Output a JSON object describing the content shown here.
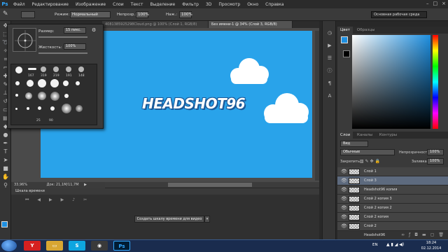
{
  "menubar": {
    "logo": "Ps",
    "items": [
      "Файл",
      "Редактирование",
      "Изображение",
      "Слои",
      "Текст",
      "Выделение",
      "Фильтр",
      "3D",
      "Просмотр",
      "Окно",
      "Справка"
    ],
    "window_controls": [
      "–",
      "□",
      "×"
    ]
  },
  "options": {
    "mode_label": "Режим:",
    "mode_value": "Нормальный",
    "opacity_label": "Непрозр.:",
    "opacity_value": "100%",
    "flow_label": "Наж.:",
    "flow_value": "100%",
    "workspace": "Основная рабочая среда"
  },
  "tabs": [
    {
      "label": "4081385925298Cloud.png @ 100% (Слой 1, RGB/8)",
      "active": false
    },
    {
      "label": "Без имени-1 @ 34% (Слой 3, RGB/8)",
      "active": true
    }
  ],
  "canvas": {
    "title_text": "HEADSHOT96",
    "background": "#29a3ea"
  },
  "brush_panel": {
    "size_label": "Размер:",
    "size_value": "15 пикс.",
    "hardness_label": "Жесткость:",
    "hardness_value": "100%",
    "preset_sizes_row1": [
      "167",
      "319",
      "219",
      "191",
      "148"
    ],
    "preset_sizes_row5": [
      "25",
      "90"
    ]
  },
  "status": {
    "zoom": "33,96%",
    "doc": "Док: 21,1M/11,7M"
  },
  "timeline": {
    "title": "Шкала времени",
    "create_button": "Создать шкалу времени для видео"
  },
  "color_panel": {
    "tabs": [
      "Цвет",
      "Образцы"
    ],
    "foreground": "#1e8fe0",
    "background": "#000000"
  },
  "layers_panel": {
    "tabs": [
      "Слои",
      "Каналы",
      "Контуры"
    ],
    "filter_label": "Вид",
    "blend_mode": "Обычные",
    "opacity_label": "Непрозрачность:",
    "opacity_value": "100%",
    "lock_label": "Закрепить:",
    "fill_label": "Заливка:",
    "fill_value": "100%",
    "layers": [
      {
        "name": "Слой 1",
        "selected": false
      },
      {
        "name": "Слой 3",
        "selected": true
      },
      {
        "name": "Headshot96 копия",
        "selected": false
      },
      {
        "name": "Слой 2 копия 3",
        "selected": false
      },
      {
        "name": "Слой 2 копия 2",
        "selected": false
      },
      {
        "name": "Слой 2 копия",
        "selected": false
      },
      {
        "name": "Слой 2",
        "selected": false
      },
      {
        "name": "Headshot96",
        "selected": false
      }
    ]
  },
  "taskbar": {
    "language": "EN",
    "time": "18:24",
    "date": "02.12.2014"
  }
}
